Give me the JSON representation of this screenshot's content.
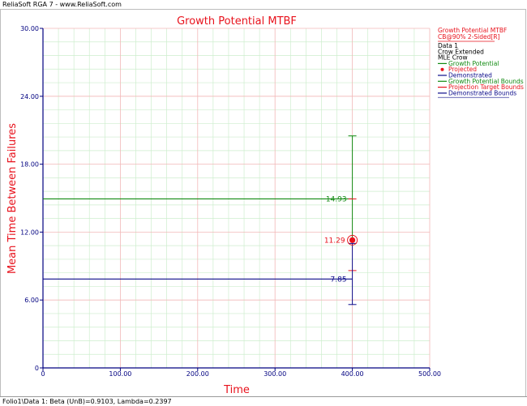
{
  "window": {
    "header_text": "ReliaSoft RGA 7 - www.ReliaSoft.com"
  },
  "status": {
    "footer_text": "Folio1\\Data 1: Beta (UnB)=0.9103, Lambda=0.2397"
  },
  "colors": {
    "title": "#e8121c",
    "axis": "#000080",
    "growth": "#118a11",
    "projected": "#e8121c",
    "demonstrated": "#0b0b8a",
    "grid_major": "#f2b8b8",
    "grid_minor": "#cdeecd"
  },
  "chart_data": {
    "type": "line",
    "title": "Growth Potential MTBF",
    "xlabel": "Time",
    "ylabel": "Mean Time Between Failures",
    "xlim": [
      0,
      500
    ],
    "ylim": [
      0,
      30
    ],
    "x_ticks": [
      0,
      100,
      200,
      300,
      400,
      500
    ],
    "x_tick_labels": [
      "0",
      "100.00",
      "200.00",
      "300.00",
      "400.00",
      "500.00"
    ],
    "y_ticks": [
      0,
      6,
      12,
      18,
      24,
      30
    ],
    "y_tick_labels": [
      "0",
      "6.00",
      "12.00",
      "18.00",
      "24.00",
      "30.00"
    ],
    "grid": true,
    "legend_position": "top-right",
    "legend_header": [
      "Growth Potential MTBF",
      "CB@90% 2-Sided[R]"
    ],
    "legend_subheader": [
      "Data 1",
      "Crow Extended",
      "MLE Crow"
    ],
    "legend_entries": [
      "Growth Potential",
      "Projected",
      "Demonstrated",
      "Growth Potential Bounds",
      "Projection Target Bounds",
      "Demonstrated Bounds"
    ],
    "series": [
      {
        "name": "Growth Potential",
        "x": [
          0,
          400
        ],
        "y": [
          14.93,
          14.93
        ],
        "label": "14.93"
      },
      {
        "name": "Projected",
        "x": [
          400
        ],
        "y": [
          11.29
        ],
        "label": "11.29"
      },
      {
        "name": "Demonstrated",
        "x": [
          0,
          400
        ],
        "y": [
          7.85,
          7.85
        ],
        "label": "7.85"
      }
    ],
    "bounds": [
      {
        "name": "Growth Potential Bounds",
        "x": 400,
        "lower": 11.1,
        "upper": 20.5
      },
      {
        "name": "Projection Target Bounds",
        "x": 400,
        "lower": 8.6,
        "upper": 14.93
      },
      {
        "name": "Demonstrated Bounds",
        "x": 400,
        "lower": 5.6,
        "upper": 11.0
      }
    ]
  }
}
